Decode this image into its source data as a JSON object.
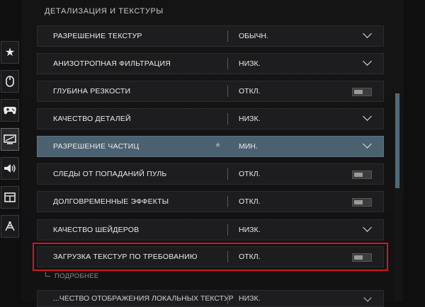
{
  "section": {
    "title": "ДЕТАЛИЗАЦИЯ И ТЕКСТУРЫ"
  },
  "sidebar": {
    "items": [
      {
        "icon": "star-icon"
      },
      {
        "icon": "mouse-icon"
      },
      {
        "icon": "gamepad-icon"
      },
      {
        "icon": "display-icon",
        "active": true
      },
      {
        "icon": "speaker-icon"
      },
      {
        "icon": "interface-icon"
      },
      {
        "icon": "network-icon"
      }
    ]
  },
  "settings": [
    {
      "label": "РАЗРЕШЕНИЕ ТЕКСТУР",
      "value": "ОБЫЧН.",
      "control": "dropdown"
    },
    {
      "label": "АНИЗОТРОПНАЯ ФИЛЬТРАЦИЯ",
      "value": "НИЗК.",
      "control": "dropdown"
    },
    {
      "label": "ГЛУБИНА РЕЗКОСТИ",
      "value": "ОТКЛ.",
      "control": "toggle"
    },
    {
      "label": "КАЧЕСТВО ДЕТАЛЕЙ",
      "value": "НИЗК.",
      "control": "dropdown"
    },
    {
      "label": "РАЗРЕШЕНИЕ ЧАСТИЦ",
      "value": "МИН.",
      "control": "dropdown",
      "highlighted": true
    },
    {
      "label": "СЛЕДЫ ОТ ПОПАДАНИЙ ПУЛЬ",
      "value": "ОТКЛ.",
      "control": "toggle"
    },
    {
      "label": "ДОЛГОВРЕМЕННЫЕ ЭФФЕКТЫ",
      "value": "ОТКЛ.",
      "control": "toggle"
    },
    {
      "label": "КАЧЕСТВО ШЕЙДЕРОВ",
      "value": "НИЗК.",
      "control": "dropdown"
    },
    {
      "label": "ЗАГРУЗКА ТЕКСТУР ПО ТРЕБОВАНИЮ",
      "value": "ОТКЛ.",
      "control": "toggle",
      "outlined": true
    }
  ],
  "more_link": "ПОДРОБНЕЕ",
  "partial_row": {
    "label": "...ЧЕСТВО ОТОБРАЖЕНИЯ ЛОКАЛЬНЫХ ТЕКСТУР",
    "value": "НИЗК."
  },
  "colors": {
    "highlight": "#4b6170",
    "outline": "#d8141e",
    "scrollbar": "#4f6a7b"
  }
}
